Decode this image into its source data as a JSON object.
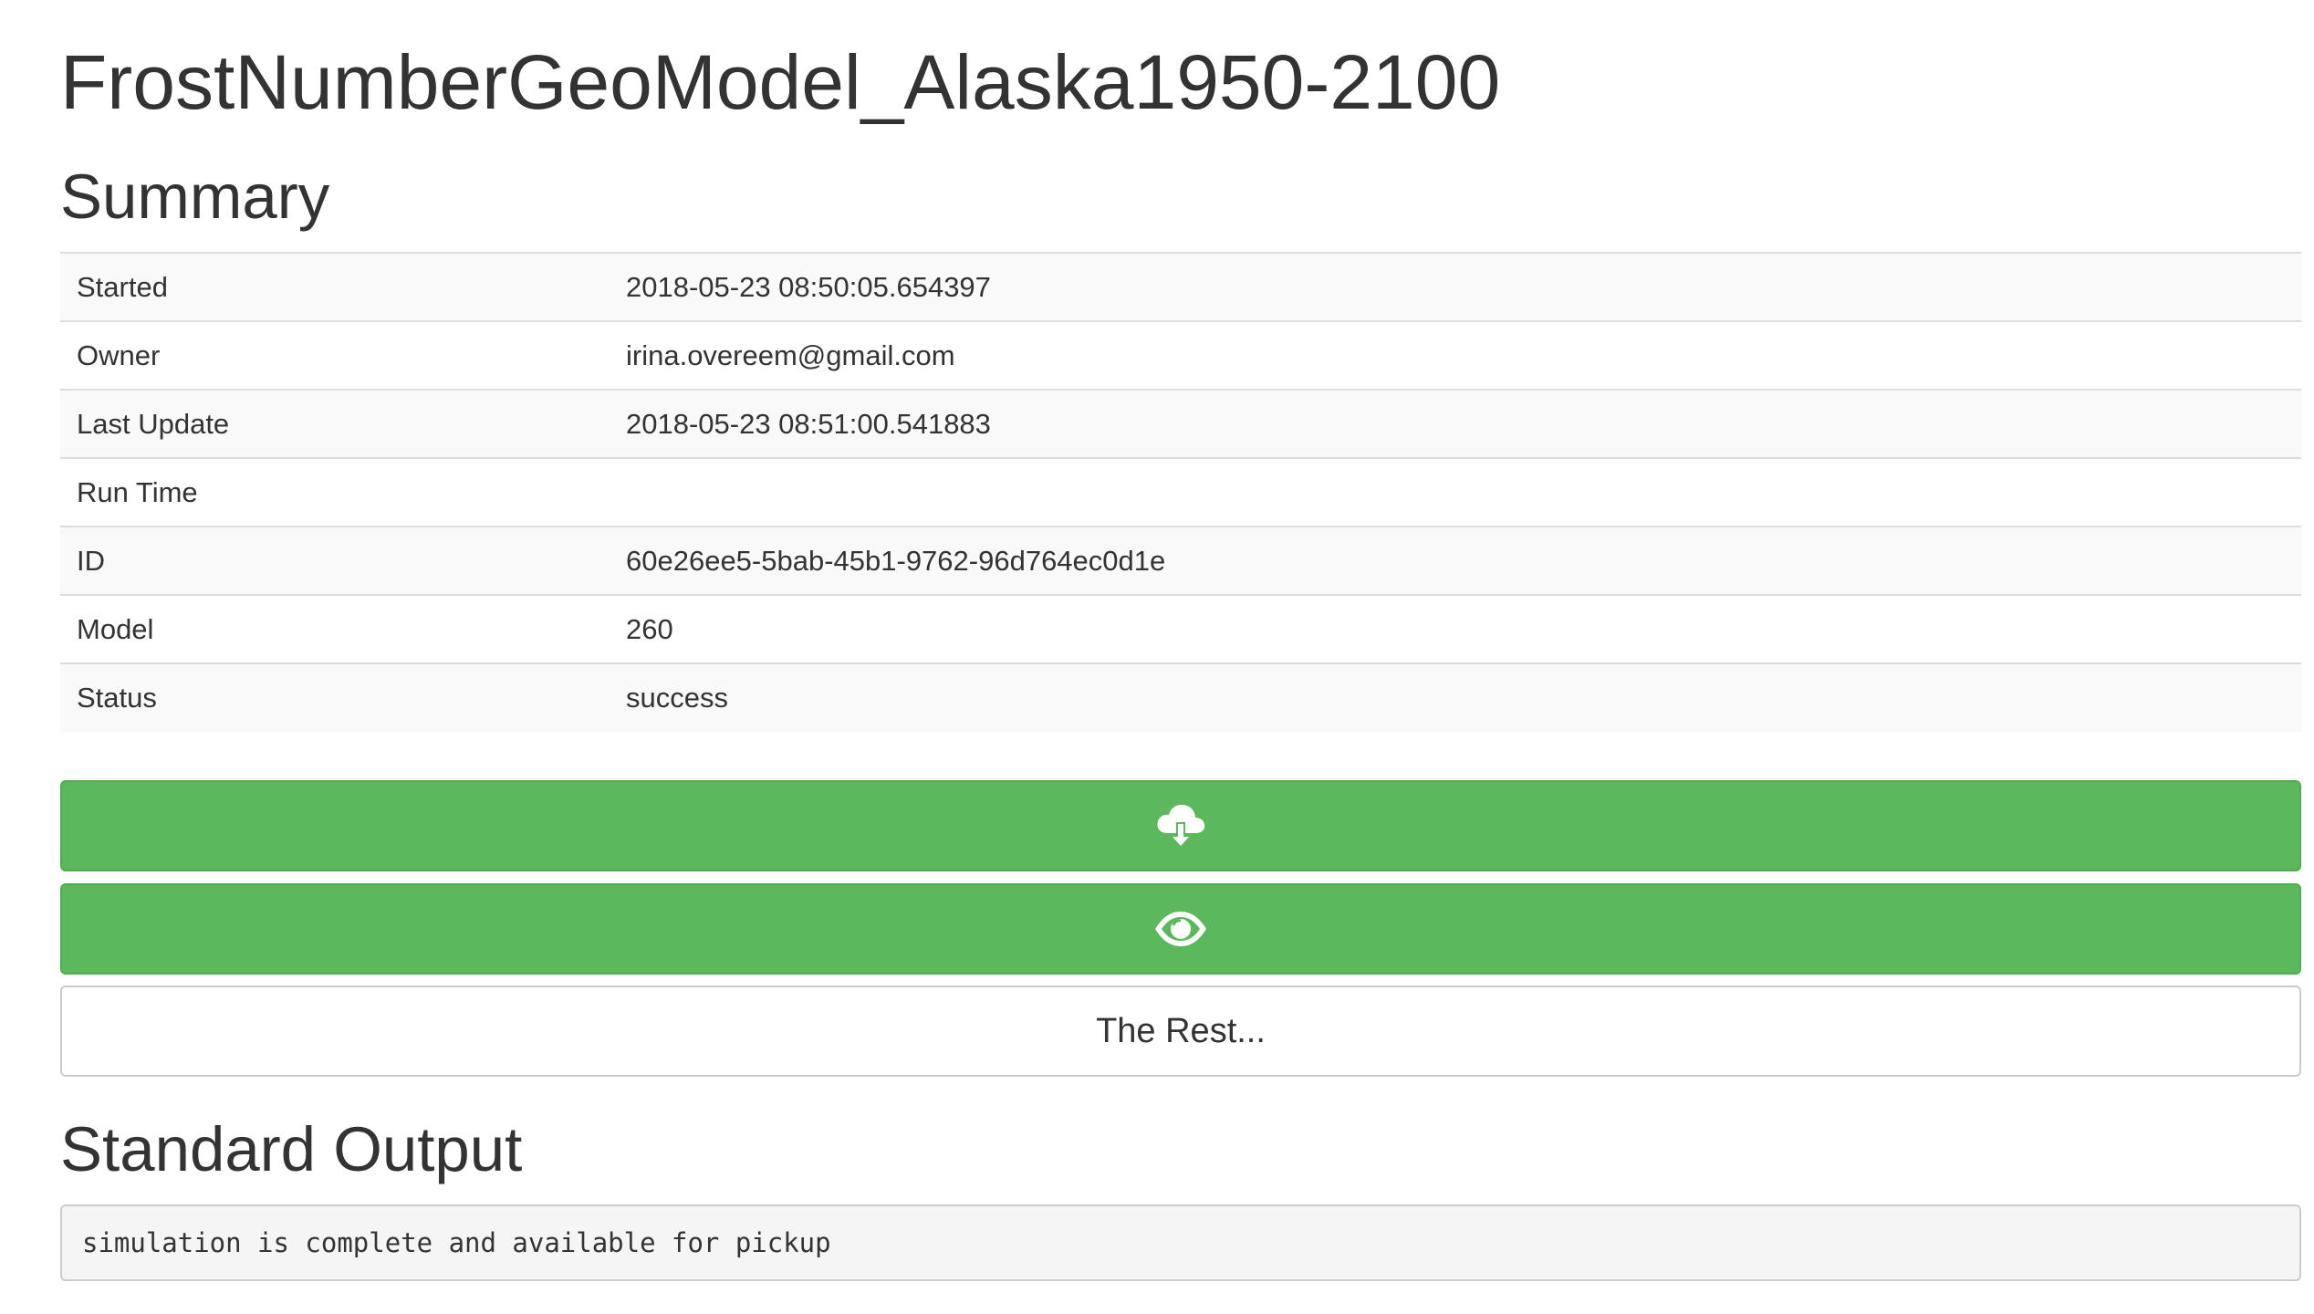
{
  "page": {
    "title": "FrostNumberGeoModel_Alaska1950-2100"
  },
  "summary": {
    "heading": "Summary",
    "rows": [
      {
        "key": "Started",
        "value": "2018-05-23 08:50:05.654397"
      },
      {
        "key": "Owner",
        "value": "irina.overeem@gmail.com"
      },
      {
        "key": "Last Update",
        "value": "2018-05-23 08:51:00.541883"
      },
      {
        "key": "Run Time",
        "value": ""
      },
      {
        "key": "ID",
        "value": "60e26ee5-5bab-45b1-9762-96d764ec0d1e"
      },
      {
        "key": "Model",
        "value": "260"
      },
      {
        "key": "Status",
        "value": "success"
      }
    ]
  },
  "actions": {
    "download_icon": "cloud-download-icon",
    "view_icon": "eye-icon",
    "rest_label": "The Rest...",
    "success_color": "#5cb85c"
  },
  "standard_output": {
    "heading": "Standard Output",
    "text": "simulation is complete and available for pickup"
  }
}
